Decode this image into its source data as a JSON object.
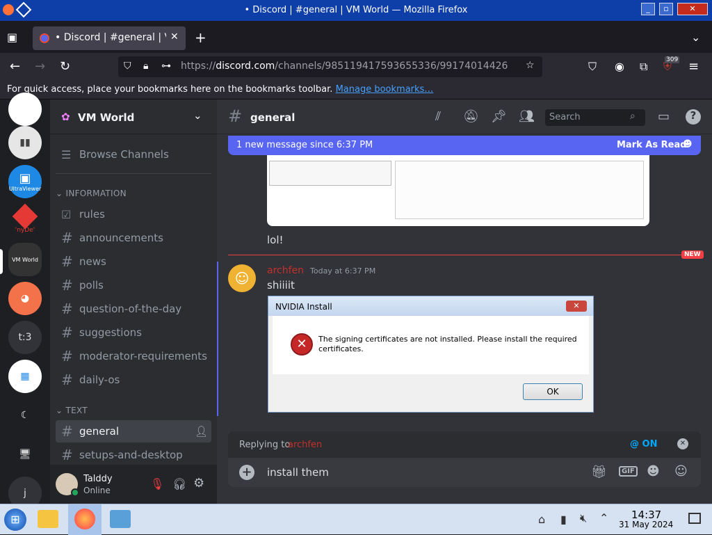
{
  "window": {
    "title": "• Discord | #general | VM World — Mozilla Firefox"
  },
  "browser": {
    "tab_title": "• Discord | #general | VM",
    "url_prefix": "https://",
    "url_domain": "discord.com",
    "url_path": "/channels/985119417593655336/99174014426",
    "badge_count": "309",
    "bookmarks_text": "For quick access, place your bookmarks here on the bookmarks toolbar.",
    "bookmarks_link": "Manage bookmarks…"
  },
  "servers": [
    {
      "label": "",
      "color": "#ffffff"
    },
    {
      "label": "",
      "color": "#e9e9e9"
    },
    {
      "label": "UltraViewer",
      "color": "#1e88e5"
    },
    {
      "label": "'nyDe'",
      "color": "#e53935"
    },
    {
      "label": "VM World",
      "color": "#444"
    },
    {
      "label": "",
      "color": "#f4724a"
    },
    {
      "label": "t:3",
      "color": "#313338"
    },
    {
      "label": "",
      "color": "#ffffff"
    },
    {
      "label": "",
      "color": "#1e1f22"
    },
    {
      "label": "",
      "color": "#1e1f22"
    },
    {
      "label": "j",
      "color": "#313338"
    }
  ],
  "sidebar": {
    "server_name": "VM World",
    "browse": "Browse Channels",
    "category_info": "INFORMATION",
    "category_text": "TEXT",
    "info_channels": [
      "rules",
      "announcements",
      "news",
      "polls",
      "question-of-the-day",
      "suggestions",
      "moderator-requirements",
      "daily-os"
    ],
    "text_channels": [
      "general",
      "setups-and-desktop"
    ]
  },
  "user": {
    "name": "Talddy",
    "status": "Online"
  },
  "channel": {
    "name": "general",
    "search_placeholder": "Search",
    "new_message_text": "1 new message since 6:37 PM",
    "mark_as_read": "Mark As Read"
  },
  "messages": {
    "prev_text": "lol!",
    "new_label": "NEW",
    "author": "archfen",
    "timestamp": "Today at 6:37 PM",
    "text": "shiiiit"
  },
  "dialog": {
    "title": "NVIDIA Install",
    "message": "The signing certificates are not installed. Please install the required certificates.",
    "ok": "OK"
  },
  "reply": {
    "replying_to": "Replying to",
    "reply_user": "archfen",
    "mention_toggle": "@ ON"
  },
  "composer": {
    "value": "install them"
  },
  "taskbar": {
    "time": "14:37",
    "date": "31 May 2024"
  },
  "colors": {
    "blurple": "#5865f2",
    "new_red": "#f23f43",
    "author_red": "#c4302b",
    "online": "#23a55a"
  }
}
